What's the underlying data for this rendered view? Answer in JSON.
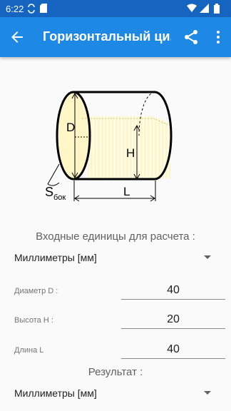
{
  "status_bar": {
    "time": "6:22"
  },
  "app_bar": {
    "back_icon": "arrow-back-icon",
    "title": "Горизонтальный ци...",
    "share_icon": "share-icon",
    "more_icon": "more-vert-icon"
  },
  "diagram": {
    "label_d": "D",
    "label_h": "H",
    "label_l": "L",
    "label_s": "S",
    "label_s_sub": "бок"
  },
  "input_section": {
    "title": "Входные единицы для расчета :",
    "units_selected": "Миллиметры [мм]"
  },
  "fields": [
    {
      "label": "Диаметр D :",
      "value": "40"
    },
    {
      "label": "Высота H :",
      "value": "20"
    },
    {
      "label": "Длина L",
      "value": "40"
    }
  ],
  "result_section": {
    "title": "Результат :",
    "units_selected": "Миллиметры [мм]"
  },
  "colors": {
    "status_bar": "#1565c0",
    "app_bar": "#1e88e5",
    "fill": "#fff6c8"
  }
}
